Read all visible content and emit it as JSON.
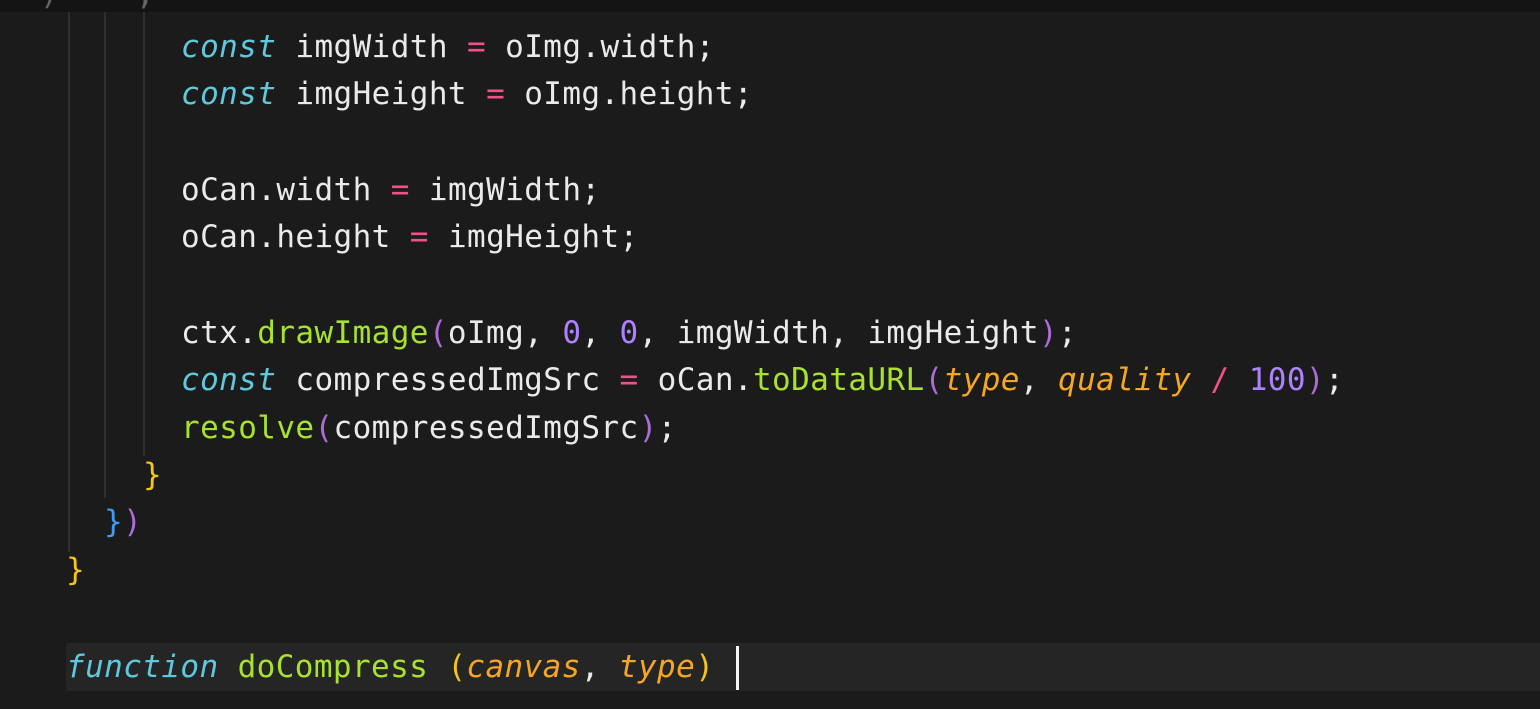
{
  "editor": {
    "language": "javascript",
    "top_cut_text": ")    ,",
    "lines": [
      {
        "tokens": [
          {
            "t": "const",
            "k": "keyword"
          },
          {
            "t": " ",
            "k": "ident"
          },
          {
            "t": "imgWidth",
            "k": "ident"
          },
          {
            "t": " ",
            "k": "ident"
          },
          {
            "t": "=",
            "k": "op"
          },
          {
            "t": " ",
            "k": "ident"
          },
          {
            "t": "oImg.width",
            "k": "ident"
          },
          {
            "t": ";",
            "k": "punct"
          }
        ]
      },
      {
        "tokens": [
          {
            "t": "const",
            "k": "keyword"
          },
          {
            "t": " ",
            "k": "ident"
          },
          {
            "t": "imgHeight",
            "k": "ident"
          },
          {
            "t": " ",
            "k": "ident"
          },
          {
            "t": "=",
            "k": "op"
          },
          {
            "t": " ",
            "k": "ident"
          },
          {
            "t": "oImg.height",
            "k": "ident"
          },
          {
            "t": ";",
            "k": "punct"
          }
        ]
      },
      {
        "tokens": []
      },
      {
        "tokens": [
          {
            "t": "oCan.width",
            "k": "ident"
          },
          {
            "t": " ",
            "k": "ident"
          },
          {
            "t": "=",
            "k": "op"
          },
          {
            "t": " ",
            "k": "ident"
          },
          {
            "t": "imgWidth",
            "k": "ident"
          },
          {
            "t": ";",
            "k": "punct"
          }
        ]
      },
      {
        "tokens": [
          {
            "t": "oCan.height",
            "k": "ident"
          },
          {
            "t": " ",
            "k": "ident"
          },
          {
            "t": "=",
            "k": "op"
          },
          {
            "t": " ",
            "k": "ident"
          },
          {
            "t": "imgHeight",
            "k": "ident"
          },
          {
            "t": ";",
            "k": "punct"
          }
        ]
      },
      {
        "tokens": []
      },
      {
        "tokens": [
          {
            "t": "ctx.",
            "k": "ident"
          },
          {
            "t": "drawImage",
            "k": "func"
          },
          {
            "t": "(",
            "k": "bracket-1"
          },
          {
            "t": "oImg, ",
            "k": "ident"
          },
          {
            "t": "0",
            "k": "number"
          },
          {
            "t": ", ",
            "k": "ident"
          },
          {
            "t": "0",
            "k": "number"
          },
          {
            "t": ", imgWidth, imgHeight",
            "k": "ident"
          },
          {
            "t": ")",
            "k": "bracket-1"
          },
          {
            "t": ";",
            "k": "punct"
          }
        ]
      },
      {
        "tokens": [
          {
            "t": "const",
            "k": "keyword"
          },
          {
            "t": " compressedImgSrc ",
            "k": "ident"
          },
          {
            "t": "=",
            "k": "op"
          },
          {
            "t": " oCan.",
            "k": "ident"
          },
          {
            "t": "toDataURL",
            "k": "func"
          },
          {
            "t": "(",
            "k": "bracket-1"
          },
          {
            "t": "type",
            "k": "param"
          },
          {
            "t": ", ",
            "k": "ident"
          },
          {
            "t": "quality",
            "k": "param"
          },
          {
            "t": " ",
            "k": "ident"
          },
          {
            "t": "/",
            "k": "op"
          },
          {
            "t": " ",
            "k": "ident"
          },
          {
            "t": "100",
            "k": "number"
          },
          {
            "t": ")",
            "k": "bracket-1"
          },
          {
            "t": ";",
            "k": "punct"
          }
        ]
      },
      {
        "tokens": [
          {
            "t": "resolve",
            "k": "func"
          },
          {
            "t": "(",
            "k": "bracket-1"
          },
          {
            "t": "compressedImgSrc",
            "k": "ident"
          },
          {
            "t": ")",
            "k": "bracket-1"
          },
          {
            "t": ";",
            "k": "punct"
          }
        ]
      },
      {
        "tokens": [
          {
            "t": "}",
            "k": "bracket-2"
          }
        ]
      },
      {
        "tokens": [
          {
            "t": "}",
            "k": "bracket-3"
          },
          {
            "t": ")",
            "k": "bracket-1"
          }
        ]
      },
      {
        "tokens": [
          {
            "t": "}",
            "k": "bracket-2"
          }
        ]
      },
      {
        "tokens": []
      },
      {
        "tokens": [
          {
            "t": "function",
            "k": "keyword"
          },
          {
            "t": " ",
            "k": "ident"
          },
          {
            "t": "doCompress",
            "k": "func"
          },
          {
            "t": " ",
            "k": "ident"
          },
          {
            "t": "(",
            "k": "bracket-2"
          },
          {
            "t": "canvas",
            "k": "param"
          },
          {
            "t": ", ",
            "k": "ident"
          },
          {
            "t": "type",
            "k": "param"
          },
          {
            "t": ")",
            "k": "bracket-2"
          }
        ]
      }
    ]
  },
  "colors": {
    "background": "#1b1b1b",
    "keyword": "#5fc8dc",
    "function": "#a6e22e",
    "operator": "#f0508c",
    "parameter": "#f5a623",
    "number": "#ae81ff"
  }
}
